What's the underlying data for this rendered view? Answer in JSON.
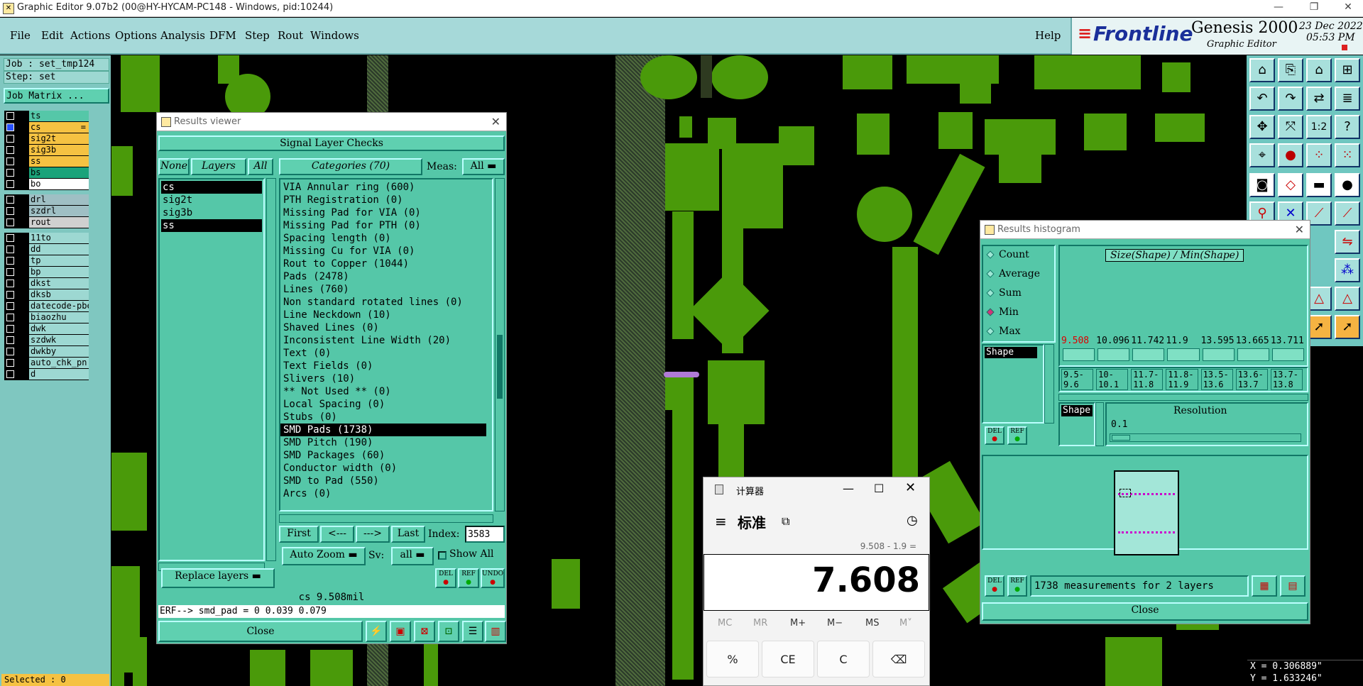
{
  "os_window": {
    "title": "Graphic Editor 9.07b2 (00@HY-HYCAM-PC148 - Windows, pid:10244)"
  },
  "menu": [
    "File",
    "Edit",
    "Actions",
    "Options",
    "Analysis",
    "DFM",
    "Step",
    "Rout",
    "Windows"
  ],
  "help_label": "Help",
  "brand": {
    "logo": "Frontline",
    "product": "Genesis 2000",
    "subtitle": "Graphic Editor",
    "date": "23 Dec 2022",
    "time": "05:53 PM"
  },
  "left_panel": {
    "job": "Job : set_tmp124",
    "step": "Step: set",
    "job_matrix": "Job Matrix ...",
    "layers_group1": [
      {
        "name": "ts",
        "color": "#55c7a8"
      },
      {
        "name": "cs",
        "color": "#f5c242",
        "marker": "="
      },
      {
        "name": "sig2t",
        "color": "#f5c242"
      },
      {
        "name": "sig3b",
        "color": "#f5c242"
      },
      {
        "name": "ss",
        "color": "#f5c242"
      },
      {
        "name": "bs",
        "color": "#1aa37a"
      },
      {
        "name": "bo",
        "color": "#ffffff"
      }
    ],
    "layers_group2": [
      {
        "name": "drl",
        "color": "#9fbfc4"
      },
      {
        "name": "szdrl",
        "color": "#9fbfc4"
      },
      {
        "name": "rout",
        "color": "#d0d0d0"
      }
    ],
    "layers_group3": [
      {
        "name": "11to",
        "color": "#9dd8d2"
      },
      {
        "name": "dd",
        "color": "#9dd8d2"
      },
      {
        "name": "tp",
        "color": "#9dd8d2"
      },
      {
        "name": "bp",
        "color": "#9dd8d2"
      },
      {
        "name": "dkst",
        "color": "#9dd8d2"
      },
      {
        "name": "dksb",
        "color": "#9dd8d2"
      },
      {
        "name": "datecode-pbe",
        "color": "#9dd8d2"
      },
      {
        "name": "biaozhu",
        "color": "#9dd8d2"
      },
      {
        "name": "dwk",
        "color": "#9dd8d2"
      },
      {
        "name": "szdwk",
        "color": "#9dd8d2"
      },
      {
        "name": "dwkby",
        "color": "#9dd8d2"
      },
      {
        "name": "auto_chk_pn",
        "color": "#9dd8d2"
      },
      {
        "name": "d",
        "color": "#9dd8d2"
      }
    ],
    "selected": "Selected : 0"
  },
  "results_viewer": {
    "title": "Results viewer",
    "header": "Signal Layer Checks",
    "none": "None",
    "layers": "Layers",
    "all": "All",
    "categories_label": "Categories (70)",
    "meas_label": "Meas:",
    "meas_value": "All",
    "layer_items": [
      {
        "name": "cs",
        "selected": true
      },
      {
        "name": "sig2t",
        "selected": false
      },
      {
        "name": "sig3b",
        "selected": false
      },
      {
        "name": "ss",
        "selected": true
      }
    ],
    "categories": [
      "VIA Annular ring (600)",
      "PTH Registration (0)",
      "Missing Pad for VIA (0)",
      "Missing Pad for PTH (0)",
      "Spacing length (0)",
      "Missing Cu for VIA (0)",
      "Rout to Copper (1044)",
      "Pads (2478)",
      "Lines (760)",
      "Non standard rotated lines (0)",
      "Line Neckdown (10)",
      "Shaved Lines (0)",
      "Inconsistent Line Width (20)",
      "Text (0)",
      "Text Fields (0)",
      "Slivers (10)",
      "** Not Used ** (0)",
      "Local Spacing (0)",
      "Stubs (0)",
      "SMD Pads (1738)",
      "SMD Pitch (190)",
      "SMD Packages (60)",
      "Conductor width (0)",
      "SMD to Pad (550)",
      "Arcs (0)"
    ],
    "selected_category": 19,
    "first": "First",
    "prev": "<---",
    "next": "--->",
    "last": "Last",
    "index_label": "Index:",
    "index_value": "3583",
    "auto_zoom": "Auto Zoom",
    "sv_label": "Sv:",
    "sv_value": "all",
    "show_all": "Show All",
    "replace_layers": "Replace layers",
    "del": "DEL",
    "ref": "REF",
    "undo": "UNDO",
    "status": "cs 9.508mil",
    "erf": "ERF--> smd_pad = 0 0.039 0.079",
    "close": "Close"
  },
  "histogram": {
    "title": "Results histogram",
    "options": [
      {
        "label": "Count",
        "checked": false
      },
      {
        "label": "Average",
        "checked": false
      },
      {
        "label": "Sum",
        "checked": false
      },
      {
        "label": "Min",
        "checked": true
      },
      {
        "label": "Max",
        "checked": false
      }
    ],
    "chart_title": "Size(Shape) / Min(Shape)",
    "list_items": [
      "Shape"
    ],
    "values": [
      "9.508",
      "10.096",
      "11.742",
      "11.9",
      "13.595",
      "13.665",
      "13.711"
    ],
    "ranges": [
      "9.5-\n9.6",
      "10-\n10.1",
      "11.7-\n11.8",
      "11.8-\n11.9",
      "13.5-\n13.6",
      "13.6-\n13.7",
      "13.7-\n13.8"
    ],
    "shape_label": "Shape",
    "resolution_label": "Resolution",
    "resolution_value": "0.1",
    "del": "DEL",
    "ref": "REF",
    "measurements": "1738 measurements for 2 layers",
    "close": "Close"
  },
  "calculator": {
    "title": "计算器",
    "mode": "标准",
    "expression": "9.508 - 1.9 =",
    "result": "7.608",
    "memory": [
      "MC",
      "MR",
      "M+",
      "M−",
      "MS",
      "M˅"
    ],
    "keys": [
      "%",
      "CE",
      "C",
      "⌫"
    ]
  },
  "coords": {
    "x": "X = 0.306889\"",
    "y": "Y = 1.633246\""
  }
}
